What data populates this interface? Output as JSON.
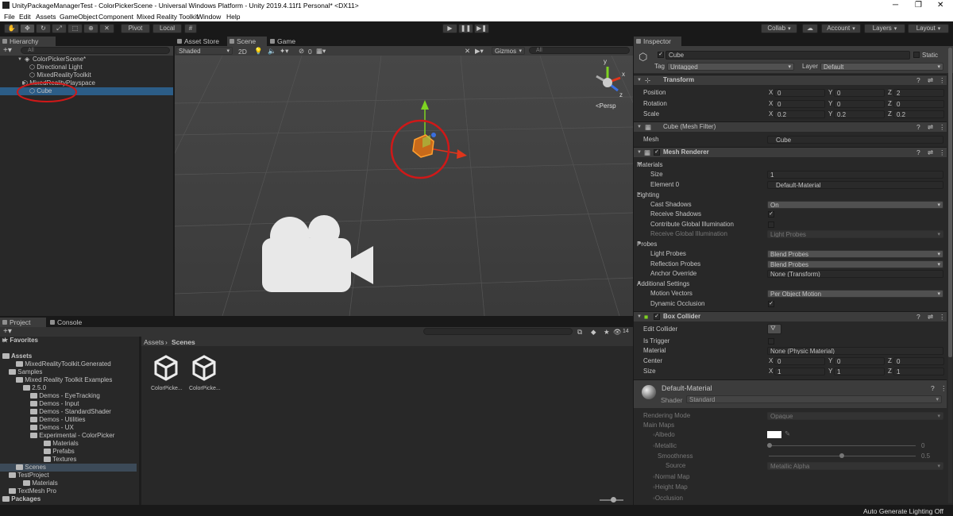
{
  "window": {
    "title": "UnityPackageManagerTest - ColorPickerScene - Universal Windows Platform - Unity 2019.4.11f1 Personal* <DX11>"
  },
  "menu": [
    "File",
    "Edit",
    "Assets",
    "GameObject",
    "Component",
    "Mixed Reality Toolkit",
    "Window",
    "Help"
  ],
  "toolbar": {
    "pivot": "Pivot",
    "local": "Local",
    "collab": "Collab",
    "account": "Account",
    "layers": "Layers",
    "layout": "Layout"
  },
  "hierarchy": {
    "tab": "Hierarchy",
    "search_placeholder": "All",
    "items": [
      "ColorPickerScene*",
      "Directional Light",
      "MixedRealityToolkit",
      "MixedRealityPlayspace",
      "Cube"
    ]
  },
  "scene": {
    "tabs": [
      "Asset Store",
      "Scene",
      "Game"
    ],
    "shading": "Shaded",
    "mode_2d": "2D",
    "hidden_count": "0",
    "gizmos": "Gizmos",
    "search_placeholder": "All",
    "gizmo": {
      "x": "x",
      "y": "y",
      "z": "z",
      "persp": "Persp"
    }
  },
  "project": {
    "tabs": [
      "Project",
      "Console"
    ],
    "favorites": "Favorites",
    "tree": [
      {
        "label": "Assets",
        "bold": true
      },
      {
        "label": "MixedRealityToolkit.Generated"
      },
      {
        "label": "Samples"
      },
      {
        "label": "Mixed Reality Toolkit Examples"
      },
      {
        "label": "2.5.0"
      },
      {
        "label": "Demos - EyeTracking"
      },
      {
        "label": "Demos - Input"
      },
      {
        "label": "Demos - StandardShader"
      },
      {
        "label": "Demos - Utilities"
      },
      {
        "label": "Demos - UX"
      },
      {
        "label": "Experimental - ColorPicker"
      },
      {
        "label": "Materials"
      },
      {
        "label": "Prefabs"
      },
      {
        "label": "Textures"
      },
      {
        "label": "Scenes"
      },
      {
        "label": "TestProject"
      },
      {
        "label": "Materials"
      },
      {
        "label": "TextMesh Pro"
      },
      {
        "label": "Packages",
        "bold": true
      }
    ],
    "breadcrumb": [
      "Assets",
      "Scenes"
    ],
    "files": [
      "ColorPicke...",
      "ColorPicke..."
    ],
    "count": "14"
  },
  "inspector": {
    "tab": "Inspector",
    "object_name": "Cube",
    "static_label": "Static",
    "tag_label": "Tag",
    "tag_value": "Untagged",
    "layer_label": "Layer",
    "layer_value": "Default",
    "transform": {
      "title": "Transform",
      "position_label": "Position",
      "position": [
        "0",
        "0",
        "2"
      ],
      "rotation_label": "Rotation",
      "rotation": [
        "0",
        "0",
        "0"
      ],
      "scale_label": "Scale",
      "scale": [
        "0.2",
        "0.2",
        "0.2"
      ]
    },
    "mesh_filter": {
      "title": "Cube (Mesh Filter)",
      "mesh_label": "Mesh",
      "mesh_value": "Cube"
    },
    "mesh_renderer": {
      "title": "Mesh Renderer",
      "materials": "Materials",
      "size_label": "Size",
      "size": "1",
      "element0_label": "Element 0",
      "element0": "Default-Material",
      "lighting": "Lighting",
      "cast_shadows_label": "Cast Shadows",
      "cast_shadows": "On",
      "receive_shadows_label": "Receive Shadows",
      "contribute_gi_label": "Contribute Global Illumination",
      "receive_gi_label": "Receive Global Illumination",
      "receive_gi": "Light Probes",
      "probes": "Probes",
      "light_probes_label": "Light Probes",
      "light_probes": "Blend Probes",
      "reflection_probes_label": "Reflection Probes",
      "reflection_probes": "Blend Probes",
      "anchor_override_label": "Anchor Override",
      "anchor_override": "None (Transform)",
      "additional": "Additional Settings",
      "motion_vectors_label": "Motion Vectors",
      "motion_vectors": "Per Object Motion",
      "dynamic_occlusion_label": "Dynamic Occlusion"
    },
    "box_collider": {
      "title": "Box Collider",
      "edit_collider_label": "Edit Collider",
      "is_trigger_label": "Is Trigger",
      "material_label": "Material",
      "material": "None (Physic Material)",
      "center_label": "Center",
      "center": [
        "0",
        "0",
        "0"
      ],
      "size_label": "Size",
      "size": [
        "1",
        "1",
        "1"
      ]
    },
    "material": {
      "name": "Default-Material",
      "shader_label": "Shader",
      "shader": "Standard",
      "rendering_mode_label": "Rendering Mode",
      "rendering_mode": "Opaque",
      "main_maps": "Main Maps",
      "albedo_label": "Albedo",
      "metallic_label": "Metallic",
      "metallic": "0",
      "smoothness_label": "Smoothness",
      "smoothness": "0.5",
      "source_label": "Source",
      "source": "Metallic Alpha",
      "normal_map_label": "Normal Map",
      "height_map_label": "Height Map",
      "occlusion_label": "Occlusion"
    }
  },
  "status": {
    "text": "Auto Generate Lighting Off"
  },
  "axes": [
    "X",
    "Y",
    "Z"
  ],
  "colors": {
    "selection": "#2c5d87",
    "annotation": "#d01818",
    "y_axis": "#7ed321",
    "x_axis": "#e0351b",
    "z_axis": "#3a6fe0"
  }
}
